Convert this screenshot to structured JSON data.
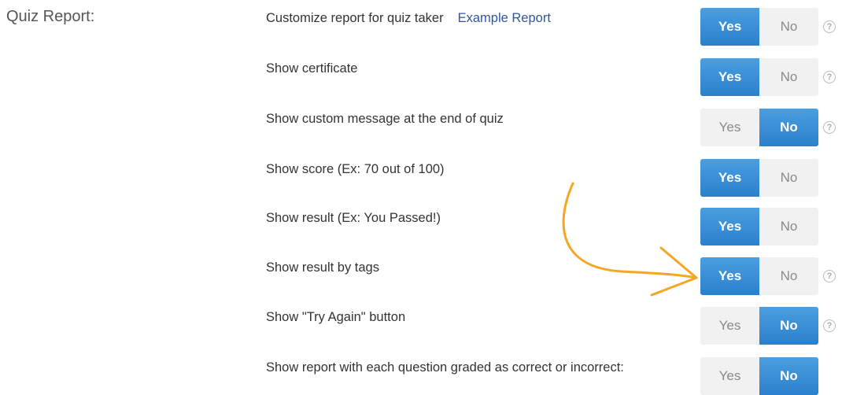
{
  "section": {
    "title": "Quiz Report:"
  },
  "toggle_labels": {
    "yes": "Yes",
    "no": "No",
    "help": "?"
  },
  "rows": [
    {
      "label": "Customize report for quiz taker",
      "link": "Example Report",
      "value": "Yes",
      "help": true
    },
    {
      "label": "Show certificate",
      "value": "Yes",
      "help": true
    },
    {
      "label": "Show custom message at the end of quiz",
      "value": "No",
      "help": true
    },
    {
      "label": "Show score (Ex: 70 out of 100)",
      "value": "Yes",
      "help": false
    },
    {
      "label": "Show result (Ex: You Passed!)",
      "value": "Yes",
      "help": false
    },
    {
      "label": "Show result by tags",
      "value": "Yes",
      "help": true
    },
    {
      "label": "Show \"Try Again\" button",
      "value": "No",
      "help": true
    },
    {
      "label": "Show report with each question graded as correct or incorrect:",
      "value": "No",
      "help": false
    }
  ],
  "colors": {
    "accent": "#2b80cc",
    "arrow": "#f5a623",
    "link": "#2f56a0"
  }
}
